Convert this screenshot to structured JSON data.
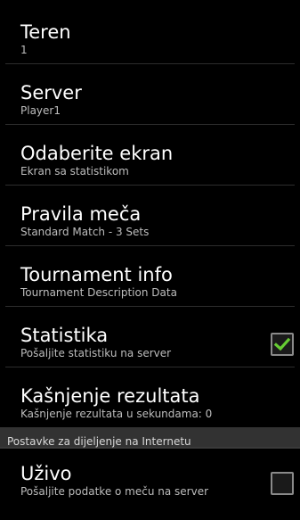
{
  "colors": {
    "background": "#000000",
    "title_text": "#ffffff",
    "summary_text": "#bdbdbd",
    "category_bar": "#323232",
    "check_mark": "#66cc33"
  },
  "preferences": [
    {
      "title": "Teren",
      "summary": "1"
    },
    {
      "title": "Server",
      "summary": "Player1"
    },
    {
      "title": "Odaberite ekran",
      "summary": "Ekran sa statistikom"
    },
    {
      "title": "Pravila meča",
      "summary": "Standard Match - 3 Sets"
    },
    {
      "title": "Tournament info",
      "summary": "Tournament Description Data"
    },
    {
      "title": "Statistika",
      "summary": "Pošaljite statistiku na server",
      "checked": true,
      "checkbox_icon": "check-icon"
    },
    {
      "title": "Kašnjenje rezultata",
      "summary": "Kašnjenje rezultata u sekundama: 0"
    }
  ],
  "category": {
    "title": "Postavke za dijeljenje na Internetu"
  },
  "internet_preferences": [
    {
      "title": "Uživo",
      "summary": "Pošaljite podatke o meču na server",
      "checked": false
    }
  ]
}
